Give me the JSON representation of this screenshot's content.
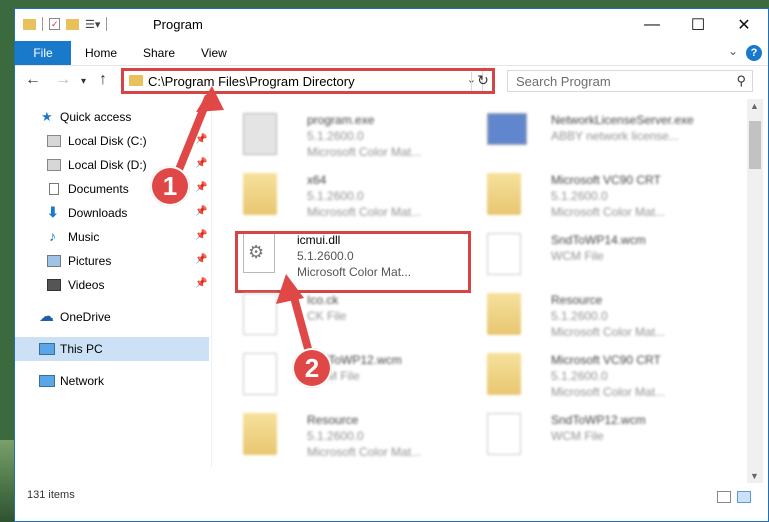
{
  "window": {
    "title": "Program",
    "controls": {
      "minimize": "—",
      "maximize": "☐",
      "close": "✕"
    }
  },
  "ribbon": {
    "tabs": [
      "File",
      "Home",
      "Share",
      "View"
    ]
  },
  "navigation": {
    "address": "C:\\Program Files\\Program Directory",
    "search_placeholder": "Search Program"
  },
  "sidebar": {
    "items": [
      {
        "label": "Quick access",
        "icon": "star-icon"
      },
      {
        "label": "Local Disk (C:)",
        "icon": "drive-icon",
        "pinned": true
      },
      {
        "label": "Local Disk (D:)",
        "icon": "drive-icon",
        "pinned": true
      },
      {
        "label": "Documents",
        "icon": "documents-icon",
        "pinned": true
      },
      {
        "label": "Downloads",
        "icon": "download-icon",
        "pinned": true
      },
      {
        "label": "Music",
        "icon": "music-icon",
        "pinned": true
      },
      {
        "label": "Pictures",
        "icon": "pictures-icon",
        "pinned": true
      },
      {
        "label": "Videos",
        "icon": "videos-icon",
        "pinned": true
      },
      {
        "label": "OneDrive",
        "icon": "cloud-icon"
      },
      {
        "label": "This PC",
        "icon": "pc-icon",
        "selected": true
      },
      {
        "label": "Network",
        "icon": "network-icon"
      }
    ]
  },
  "files": [
    {
      "name": "program.exe",
      "line2": "5.1.2600.0",
      "line3": "Microsoft Color Mat...",
      "icon": "exe-icon"
    },
    {
      "name": "NetworkLicenseServer.exe",
      "line2": "ABBY network license...",
      "line3": "",
      "icon": "exe-blue-icon"
    },
    {
      "name": "x64",
      "line2": "5.1.2600.0",
      "line3": "Microsoft Color Mat...",
      "icon": "folder-icon"
    },
    {
      "name": "Microsoft VC90 CRT",
      "line2": "5.1.2600.0",
      "line3": "Microsoft Color Mat...",
      "icon": "folder-icon"
    },
    {
      "name": "icmui.dll",
      "line2": "5.1.2600.0",
      "line3": "Microsoft Color Mat...",
      "icon": "dll-gear-icon"
    },
    {
      "name": "SndToWP14.wcm",
      "line2": "WCM File",
      "line3": "",
      "icon": "document-icon"
    },
    {
      "name": "Ico.ck",
      "line2": "CK File",
      "line3": "",
      "icon": "document-icon"
    },
    {
      "name": "Resource",
      "line2": "5.1.2600.0",
      "line3": "Microsoft Color Mat...",
      "icon": "folder-icon"
    },
    {
      "name": "SndToWP12.wcm",
      "line2": "WCM File",
      "line3": "",
      "icon": "document-icon"
    },
    {
      "name": "Microsoft VC90 CRT",
      "line2": "5.1.2600.0",
      "line3": "Microsoft Color Mat...",
      "icon": "folder-icon"
    },
    {
      "name": "Resource",
      "line2": "5.1.2600.0",
      "line3": "Microsoft Color Mat...",
      "icon": "folder-icon"
    },
    {
      "name": "SndToWP12.wcm",
      "line2": "WCM File",
      "line3": "",
      "icon": "document-icon"
    }
  ],
  "annotations": {
    "marker1": "1",
    "marker2": "2"
  },
  "status": {
    "count": "131 items"
  },
  "colors": {
    "accent": "#1979ca",
    "highlight": "#d64545",
    "selection": "#cce1f5"
  }
}
